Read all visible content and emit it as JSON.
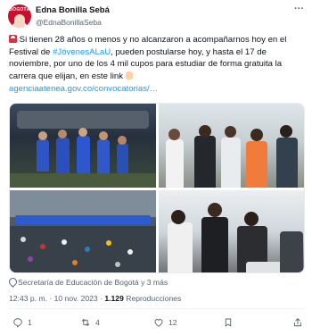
{
  "author": {
    "display_name": "Edna Bonilla Sebá",
    "handle": "@EdnaBonillaSeba",
    "avatar_text": "BOGOTÁ"
  },
  "tweet": {
    "part1": " Si tienen 28 años o menos y no alcanzaron a acompañarnos hoy en el Festival de ",
    "hashtag": "#JóvenesALaU",
    "part2": ", pueden postularse hoy, y hasta el 17 de noviembre, por uno de los 4 mil cupos para estudiar de forma gratuita la carrera que elijan, en este link ",
    "link": "agenciaatenea.gov.co/convocatorias/…"
  },
  "media": {
    "location_tag": "Secretaría de Educación de Bogotá y 3 más"
  },
  "meta": {
    "time": "12:43 p. m.",
    "separator": " · ",
    "date": "10 nov. 2023",
    "views_count": "1.129",
    "views_label": " Reproducciones"
  },
  "actions": {
    "reply_count": "1",
    "retweet_count": "4",
    "like_count": "12",
    "bookmark_count": "",
    "icons": [
      "reply-icon",
      "retweet-icon",
      "like-icon",
      "bookmark-icon",
      "share-icon"
    ]
  },
  "colors": {
    "link": "#1d9bf0",
    "text": "#0f1419",
    "secondary": "#536471"
  }
}
